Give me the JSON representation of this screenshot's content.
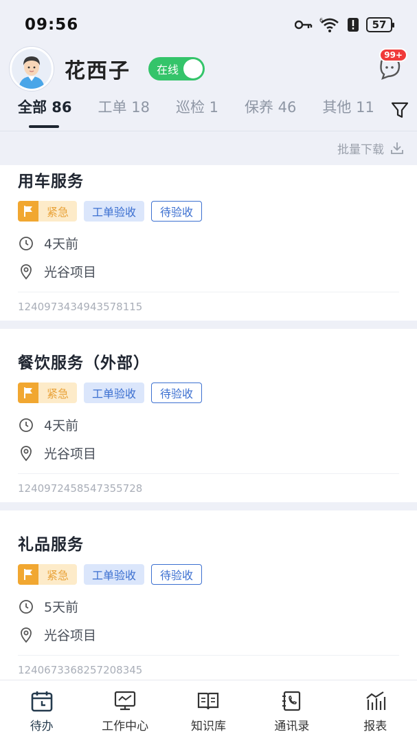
{
  "status_bar": {
    "time": "09:56",
    "battery": "57"
  },
  "header": {
    "user_name": "花西子",
    "online_label": "在线",
    "message_badge": "99+"
  },
  "tabs": [
    {
      "label": "全部 86",
      "active": true
    },
    {
      "label": "工单 18",
      "active": false
    },
    {
      "label": "巡检 1",
      "active": false
    },
    {
      "label": "保养 46",
      "active": false
    },
    {
      "label": "其他 11",
      "active": false
    }
  ],
  "toolbar": {
    "bulk_download": "批量下载"
  },
  "cards": [
    {
      "title": "用车服务",
      "tags": {
        "urgent": "紧急",
        "type": "工单验收",
        "status": "待验收"
      },
      "time": "4天前",
      "location": "光谷项目",
      "id": "1240973434943578115"
    },
    {
      "title": "餐饮服务（外部）",
      "tags": {
        "urgent": "紧急",
        "type": "工单验收",
        "status": "待验收"
      },
      "time": "4天前",
      "location": "光谷项目",
      "id": "1240972458547355728"
    },
    {
      "title": "礼品服务",
      "tags": {
        "urgent": "紧急",
        "type": "工单验收",
        "status": "待验收"
      },
      "time": "5天前",
      "location": "光谷项目",
      "id": "1240673368257208345"
    }
  ],
  "nav": [
    {
      "label": "待办",
      "icon": "calendar-icon"
    },
    {
      "label": "工作中心",
      "icon": "monitor-icon"
    },
    {
      "label": "知识库",
      "icon": "book-icon"
    },
    {
      "label": "通讯录",
      "icon": "phone-book-icon"
    },
    {
      "label": "报表",
      "icon": "chart-icon"
    }
  ],
  "colors": {
    "accent": "#1d2530",
    "online": "#34c46a",
    "urgent": "#f1a731",
    "tag_blue": "#3b6fd0"
  }
}
